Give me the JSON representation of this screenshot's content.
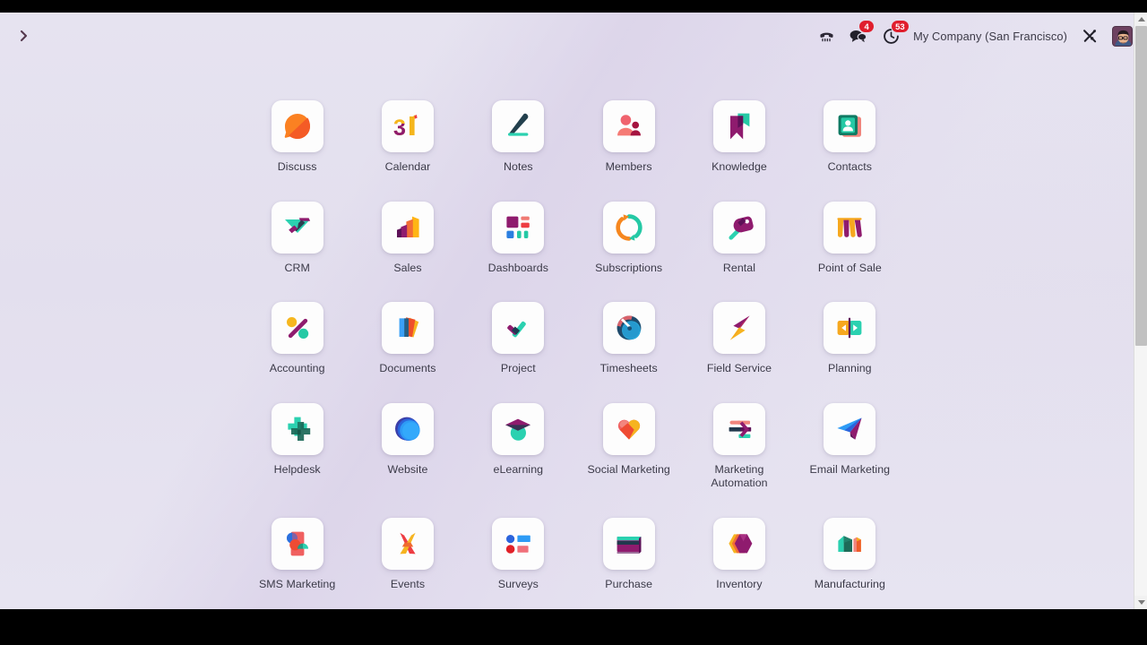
{
  "window": {
    "background_color": "#e4e1ee",
    "letterbox_color": "#000000"
  },
  "navbar": {
    "toggle_icon": "chevron-right-icon",
    "phone_icon": "phone-icon",
    "messages": {
      "icon": "messages-icon",
      "badge": "4"
    },
    "activities": {
      "icon": "activities-clock-icon",
      "badge": "53"
    },
    "company": "My Company (San Francisco)",
    "tools_icon": "tools-icon",
    "avatar_label": "user-avatar",
    "badge_color": "#e01e2d"
  },
  "apps": [
    {
      "label": "Discuss",
      "icon": "discuss-icon"
    },
    {
      "label": "Calendar",
      "icon": "calendar-icon"
    },
    {
      "label": "Notes",
      "icon": "notes-icon"
    },
    {
      "label": "Members",
      "icon": "members-icon"
    },
    {
      "label": "Knowledge",
      "icon": "knowledge-icon"
    },
    {
      "label": "Contacts",
      "icon": "contacts-icon"
    },
    {
      "label": "CRM",
      "icon": "crm-icon"
    },
    {
      "label": "Sales",
      "icon": "sales-icon"
    },
    {
      "label": "Dashboards",
      "icon": "dashboards-icon"
    },
    {
      "label": "Subscriptions",
      "icon": "subscriptions-icon"
    },
    {
      "label": "Rental",
      "icon": "rental-icon"
    },
    {
      "label": "Point of Sale",
      "icon": "point-of-sale-icon"
    },
    {
      "label": "Accounting",
      "icon": "accounting-icon"
    },
    {
      "label": "Documents",
      "icon": "documents-icon"
    },
    {
      "label": "Project",
      "icon": "project-icon"
    },
    {
      "label": "Timesheets",
      "icon": "timesheets-icon"
    },
    {
      "label": "Field Service",
      "icon": "field-service-icon"
    },
    {
      "label": "Planning",
      "icon": "planning-icon"
    },
    {
      "label": "Helpdesk",
      "icon": "helpdesk-icon"
    },
    {
      "label": "Website",
      "icon": "website-icon"
    },
    {
      "label": "eLearning",
      "icon": "elearning-icon"
    },
    {
      "label": "Social Marketing",
      "icon": "social-marketing-icon"
    },
    {
      "label": "Marketing Automation",
      "icon": "marketing-automation-icon"
    },
    {
      "label": "Email Marketing",
      "icon": "email-marketing-icon"
    },
    {
      "label": "SMS Marketing",
      "icon": "sms-marketing-icon"
    },
    {
      "label": "Events",
      "icon": "events-icon"
    },
    {
      "label": "Surveys",
      "icon": "surveys-icon"
    },
    {
      "label": "Purchase",
      "icon": "purchase-icon"
    },
    {
      "label": "Inventory",
      "icon": "inventory-icon"
    },
    {
      "label": "Manufacturing",
      "icon": "manufacturing-icon"
    }
  ],
  "scrollbar": {
    "up_arrow": "scroll-up-arrow",
    "down_arrow": "scroll-down-arrow"
  }
}
